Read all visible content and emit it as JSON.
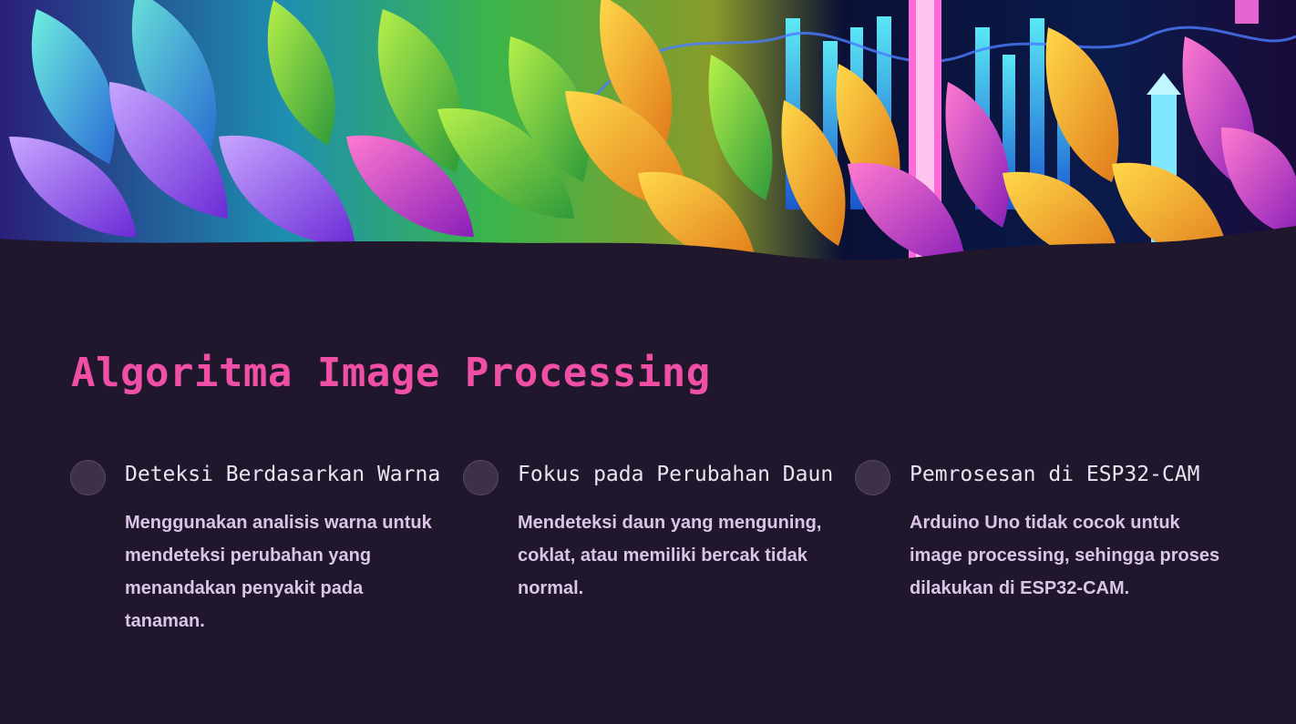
{
  "slide": {
    "title": "Algoritma Image Processing",
    "banner_image": "leaves-and-data-chart-illustration",
    "items": [
      {
        "heading": "Deteksi Berdasarkan Warna",
        "text": "Menggunakan analisis warna untuk mendeteksi perubahan yang menandakan penyakit pada tanaman."
      },
      {
        "heading": "Fokus pada Perubahan Daun",
        "text": "Mendeteksi daun yang menguning, coklat, atau memiliki bercak tidak normal."
      },
      {
        "heading": "Pemrosesan di ESP32-CAM",
        "text": "Arduino Uno tidak cocok untuk image processing, sehingga proses dilakukan di ESP32-CAM."
      }
    ]
  },
  "colors": {
    "background": "#21172d",
    "title": "#f04fa6",
    "heading": "#ece3f2",
    "body_text": "#d9c6e6",
    "bullet": "#3d3148"
  }
}
